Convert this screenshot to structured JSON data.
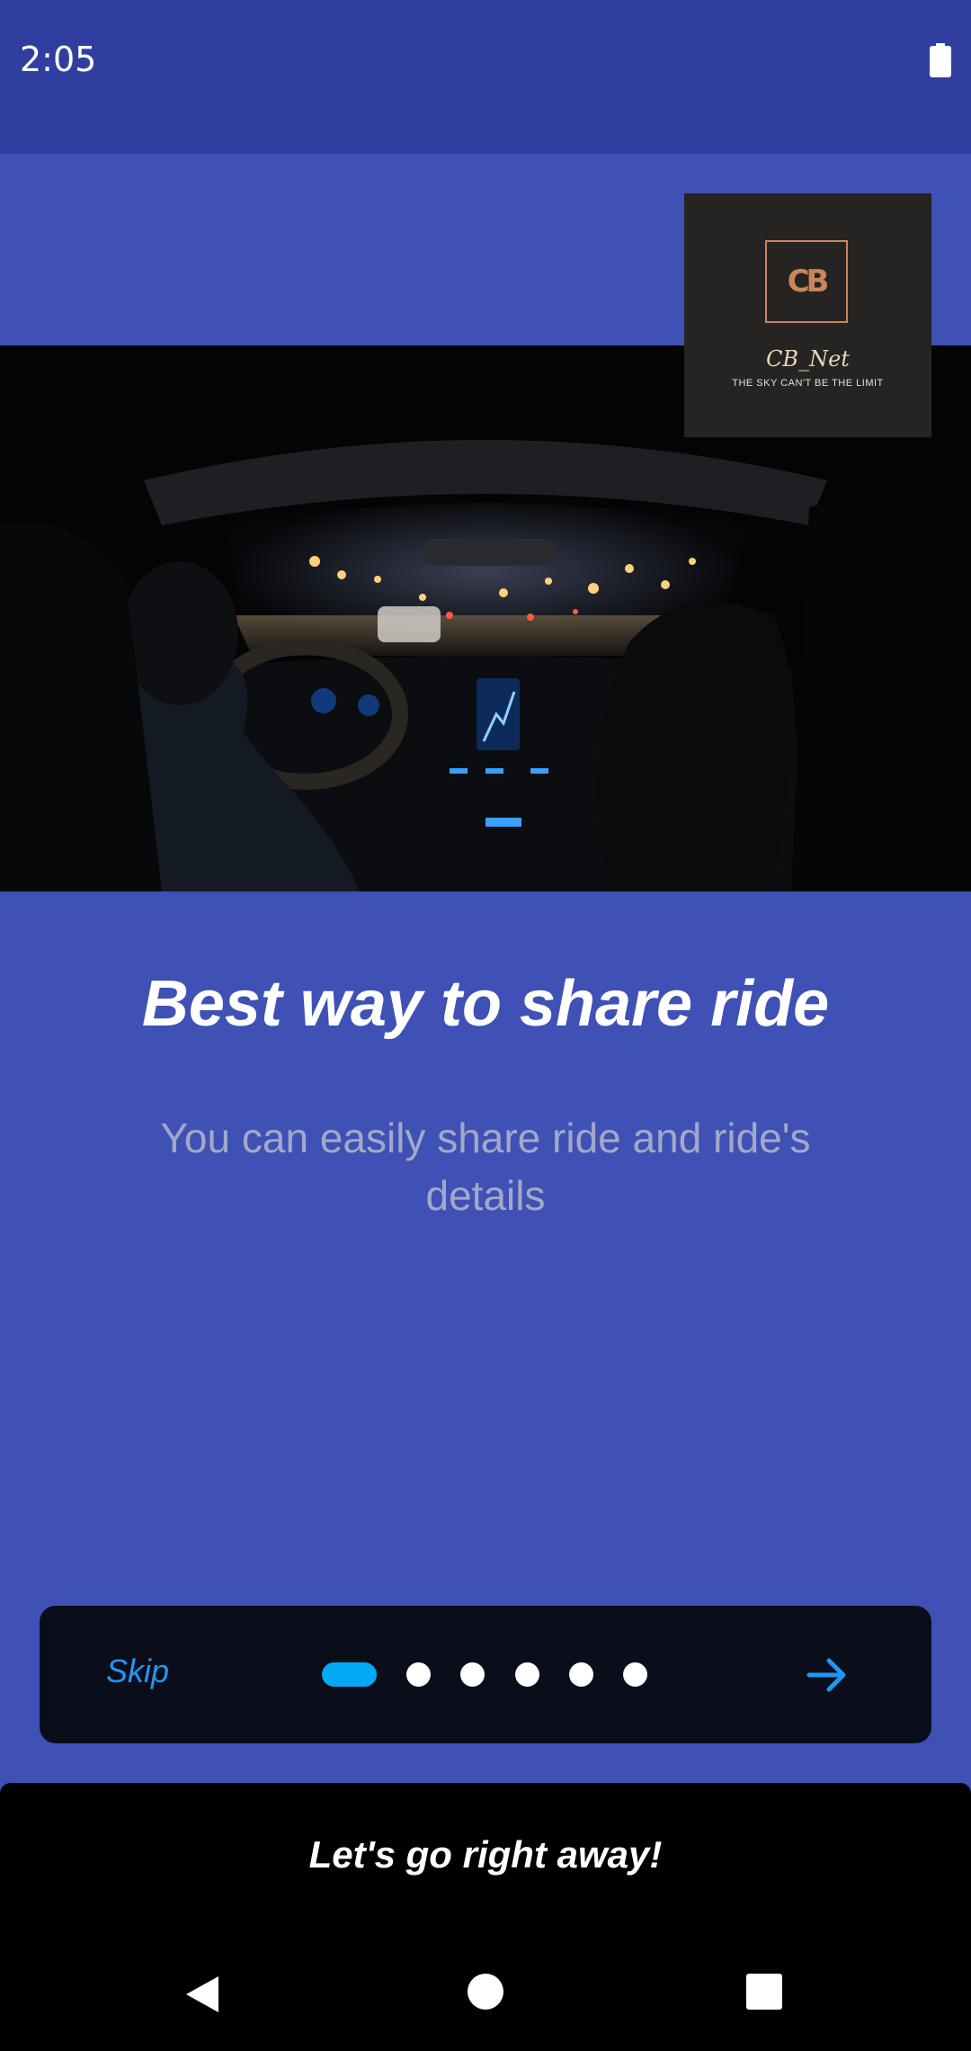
{
  "status_bar": {
    "time": "2:05",
    "battery_icon": "battery-full-icon"
  },
  "logo": {
    "mark": "CB",
    "name": "CB_Net",
    "tagline": "THE SKY CAN'T BE THE LIMIT"
  },
  "onboarding": {
    "title": "Best way to share ride",
    "subtitle": "You can easily share ride and ride's details"
  },
  "pager": {
    "skip_label": "Skip",
    "page_count": 6,
    "active_page": 1,
    "next_icon": "arrow-right-icon",
    "accent_color": "#03a9f4"
  },
  "cta": {
    "label": "Let's go right away!"
  },
  "nav": {
    "back_icon": "back-triangle-icon",
    "home_icon": "home-circle-icon",
    "recents_icon": "recents-square-icon"
  },
  "colors": {
    "background": "#3f51b5",
    "status_bar": "#303f9f",
    "pager_bg": "#0a0e1a",
    "link": "#2196f3"
  }
}
